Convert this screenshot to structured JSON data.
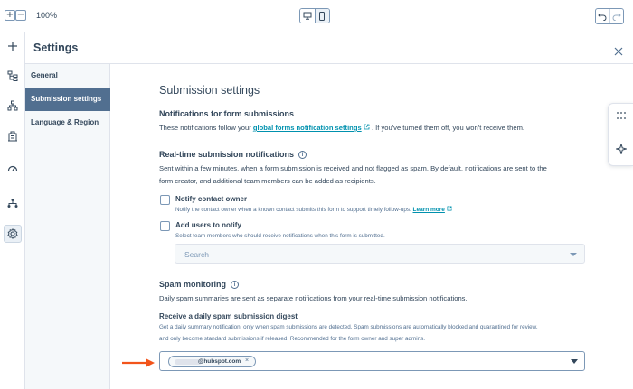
{
  "toolbar": {
    "zoom_in": "+",
    "zoom_out": "−",
    "zoom_level": "100%",
    "device_desktop_icon": "desktop-icon",
    "device_mobile_icon": "mobile-icon",
    "undo_icon": "undo-icon",
    "redo_icon": "redo-icon"
  },
  "rail": {
    "items": [
      "add-icon",
      "tree-icon",
      "workflow-icon",
      "building-icon",
      "gauge-icon",
      "hierarchy-icon",
      "gear-icon"
    ],
    "active": "gear-icon"
  },
  "settings": {
    "title": "Settings",
    "close_icon": "close-icon",
    "nav": [
      {
        "label": "General",
        "active": false
      },
      {
        "label": "Submission settings",
        "active": true
      },
      {
        "label": "Language & Region",
        "active": false
      }
    ]
  },
  "main": {
    "title": "Submission settings",
    "notifications": {
      "heading": "Notifications for form submissions",
      "text_before": "These notifications follow your",
      "link": "global forms notification settings",
      "text_after": ". If you've turned them off, you won't receive them."
    },
    "realtime": {
      "heading": "Real-time submission notifications",
      "description_line1": "Sent within a few minutes, when a form submission is received and not flagged as spam. By default, notifications are sent to the",
      "description_line2": "form creator, and additional team members can be added as recipients.",
      "notify_owner": {
        "label": "Notify contact owner",
        "help": "Notify the contact owner when a known contact submits this form to support timely follow-ups.",
        "link": "Learn more",
        "checked": false
      },
      "add_users": {
        "label": "Add users to notify",
        "help": "Select team members who should receive notifications when this form is submitted.",
        "checked": false
      },
      "search_placeholder": "Search"
    },
    "spam": {
      "heading": "Spam monitoring",
      "description": "Daily spam summaries are sent as separate notifications from your real-time submission notifications.",
      "digest_heading": "Receive a daily spam submission digest",
      "digest_help_line1": "Get a daily summary notification, only when spam submissions are detected. Spam submissions are automatically blocked and quarantined for review,",
      "digest_help_line2": "and only become standard submissions if released. Recommended for the form owner and super admins.",
      "selected_email": "@hubspot.com"
    }
  },
  "side_panel": {
    "items": [
      "grid-dots-icon",
      "sparkle-icon"
    ]
  },
  "colors": {
    "accent_link": "#0091ae",
    "nav_active": "#516f90",
    "text": "#33475b",
    "arrow": "#f2541b"
  }
}
